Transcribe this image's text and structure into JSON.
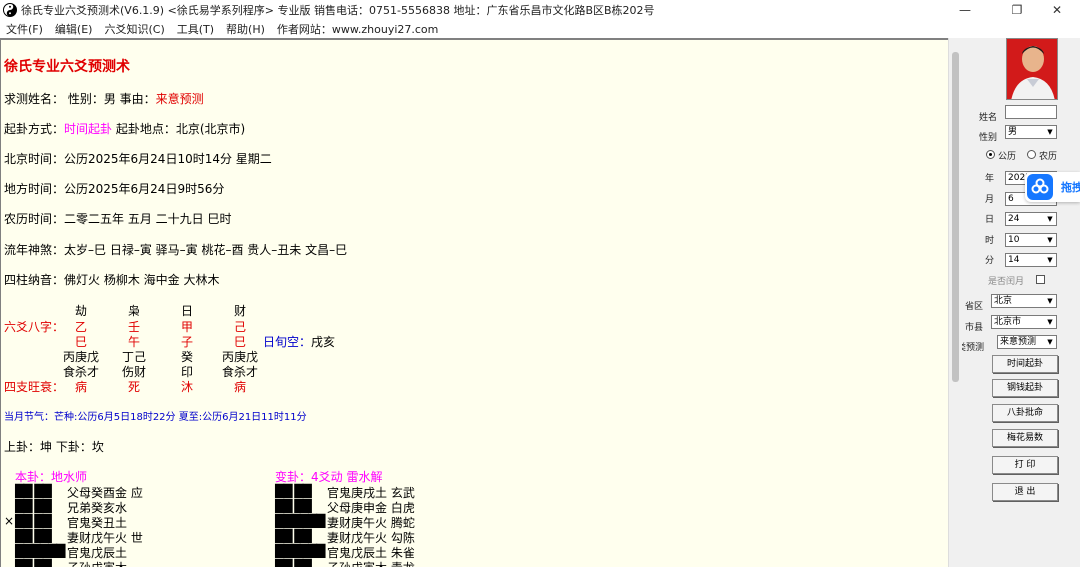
{
  "window": {
    "title": "徐氏专业六爻预测术(V6.1.9)   <徐氏易学系列程序> 专业版  销售电话：0751-5556838  地址：广东省乐昌市文化路B区B栋202号",
    "minimize_glyph": "—",
    "maximize_glyph": "❐",
    "close_glyph": "✕"
  },
  "menu": [
    "文件(F)",
    "编辑(E)",
    "六爻知识(C)",
    "工具(T)",
    "帮助(H)",
    "作者网站：www.zhouyi27.com"
  ],
  "report": {
    "heading": "徐氏专业六爻预测术",
    "query_prefix": "求测姓名：  性别：男   事由：",
    "query_reason": "来意预测",
    "method_label": "起卦方式：",
    "method_value": "时间起卦",
    "place": "   起卦地点：北京(北京市)",
    "beijing_time": "北京时间：公历2025年6月24日10时14分  星期二",
    "local_time": "地方时间：公历2025年6月24日9时56分",
    "lunar_time": "农历时间：二零二五年  五月  二十九日  巳时",
    "shensha": "流年神煞：太岁–巳 日禄–寅 驿马–寅 桃花–酉 贵人–丑未 文昌–巳",
    "nayin": "四柱纳音：佛灯火     杨柳木     海中金     大林木",
    "bazi": {
      "header": [
        "劫",
        "枭",
        "日",
        "财"
      ],
      "label": "六爻八字：",
      "stems": [
        "乙",
        "壬",
        "甲",
        "己"
      ],
      "branches": [
        "巳",
        "午",
        "子",
        "巳"
      ],
      "hidden": [
        "丙庚戊",
        "丁己",
        "癸",
        "丙庚戊"
      ],
      "gods": [
        "食杀才",
        "伤财",
        "印",
        "食杀才"
      ],
      "state_label": "四支旺衰：",
      "states": [
        "病",
        "死",
        "沐",
        "病"
      ],
      "void_label": "日旬空：",
      "void_value": "戌亥"
    },
    "jieqi": "当月节气：芒种:公历6月5日18时22分  夏至:公历6月21日11时11分",
    "upper_lower": "上卦：坤     下卦：坎",
    "ben_gua": {
      "title": "本卦：地水师",
      "lines": [
        {
          "mark": "",
          "yao": "██  ██",
          "text": "  父母癸酉金    应"
        },
        {
          "mark": "",
          "yao": "██  ██",
          "text": "  兄弟癸亥水"
        },
        {
          "mark": "×",
          "yao": "██  ██",
          "text": "  官鬼癸丑土"
        },
        {
          "mark": "",
          "yao": "██  ██",
          "text": "  妻财戊午火    世"
        },
        {
          "mark": "",
          "yao": "██████",
          "text": "  官鬼戊辰土"
        },
        {
          "mark": "",
          "yao": "██  ██",
          "text": "  子孙戊寅木"
        }
      ]
    },
    "bian_gua": {
      "title": "变卦：4爻动  雷水解",
      "lines": [
        {
          "yao": "██  ██",
          "text": "  官鬼庚戌土      玄武"
        },
        {
          "yao": "██  ██",
          "text": "  父母庚申金      白虎"
        },
        {
          "yao": "██████",
          "text": "  妻财庚午火      腾蛇"
        },
        {
          "yao": "██  ██",
          "text": "  妻财戊午火      勾陈"
        },
        {
          "yao": "██████",
          "text": "  官鬼戊辰土      朱雀"
        },
        {
          "yao": "██  ██",
          "text": "  子孙戊寅木      青龙"
        }
      ]
    }
  },
  "side_panel": {
    "name_label": "姓名",
    "name_value": "",
    "gender_label": "性别",
    "gender_value": "男",
    "calendar_solar": "公历",
    "calendar_lunar": "农历",
    "year_label": "年",
    "year_value": "2025",
    "month_label": "月",
    "month_value": "6",
    "day_label": "日",
    "day_value": "24",
    "hour_label": "时",
    "hour_value": "10",
    "minute_label": "分",
    "minute_value": "14",
    "leap_label": "是否闰月",
    "province_label": "省区",
    "province_value": "北京",
    "city_label": "市县",
    "city_value": "北京市",
    "category_label": "分类预测",
    "category_value": "来意预测",
    "buttons": [
      "时间起卦",
      "钢钱起卦",
      "八卦批命",
      "梅花易数",
      "打 印",
      "退 出"
    ]
  },
  "floating_widget": {
    "label": "拖拽"
  },
  "colors": {
    "report_bg": "#ffffee",
    "red": "#e00000",
    "magenta": "#ff00ff",
    "blue": "#0000cc",
    "accent": "#1677ff"
  }
}
